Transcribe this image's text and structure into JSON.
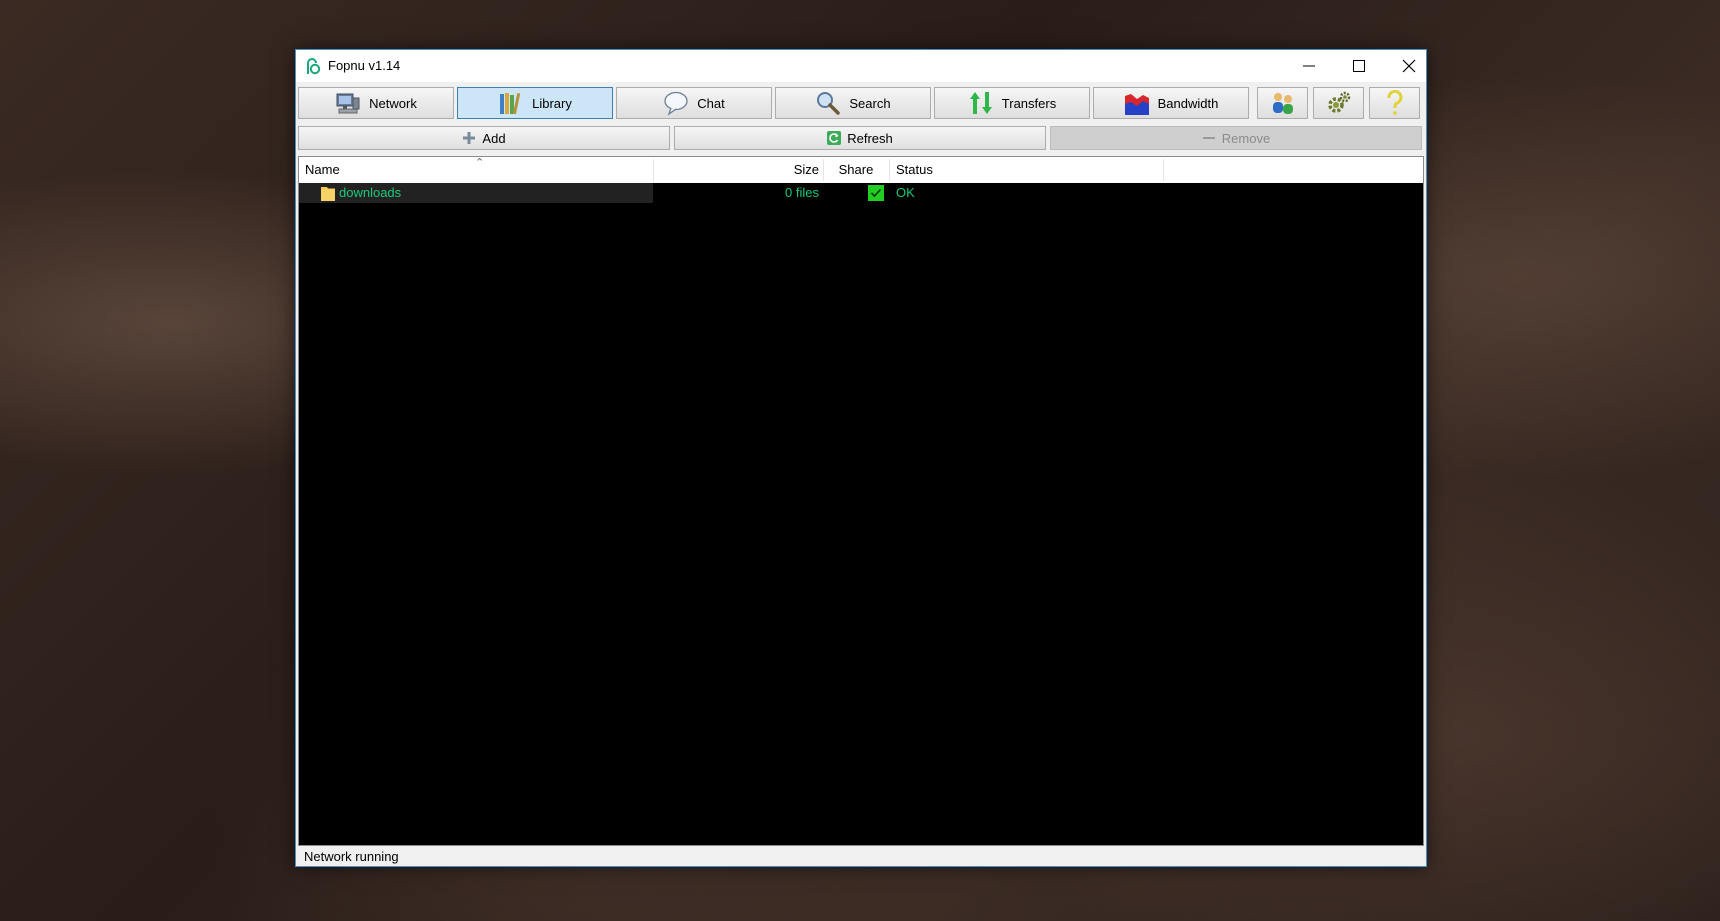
{
  "window": {
    "title": "Fopnu v1.14",
    "app_icon": "fopnu-logo-icon",
    "controls": [
      "minimize-icon",
      "maximize-icon",
      "close-icon"
    ]
  },
  "toolbar": {
    "active_tab": "Library",
    "tabs": [
      {
        "label": "Network",
        "icon": "network-computer-icon"
      },
      {
        "label": "Library",
        "icon": "library-books-icon"
      },
      {
        "label": "Chat",
        "icon": "chat-bubble-icon"
      },
      {
        "label": "Search",
        "icon": "magnifier-icon"
      },
      {
        "label": "Transfers",
        "icon": "transfer-arrows-icon"
      },
      {
        "label": "Bandwidth",
        "icon": "bandwidth-graph-icon"
      }
    ],
    "icon_buttons": [
      "users-icon",
      "settings-gears-icon",
      "help-question-icon"
    ]
  },
  "actions": {
    "add": {
      "label": "Add",
      "icon": "plus-icon"
    },
    "refresh": {
      "label": "Refresh",
      "icon": "refresh-icon"
    },
    "remove": {
      "label": "Remove",
      "icon": "minus-icon",
      "disabled": true
    }
  },
  "library_list": {
    "columns": [
      "Name",
      "Size",
      "Share",
      "Status"
    ],
    "sort_column": "Name",
    "rows": [
      {
        "name": "downloads",
        "icon": "folder-icon",
        "size": "0 files",
        "share": true,
        "status": "OK"
      }
    ]
  },
  "statusbar": {
    "text": "Network running"
  },
  "colors": {
    "list_background": "#000000",
    "row_text": "#18c878",
    "active_tab_background": "#cde6f7",
    "share_check": "#22cc22"
  }
}
